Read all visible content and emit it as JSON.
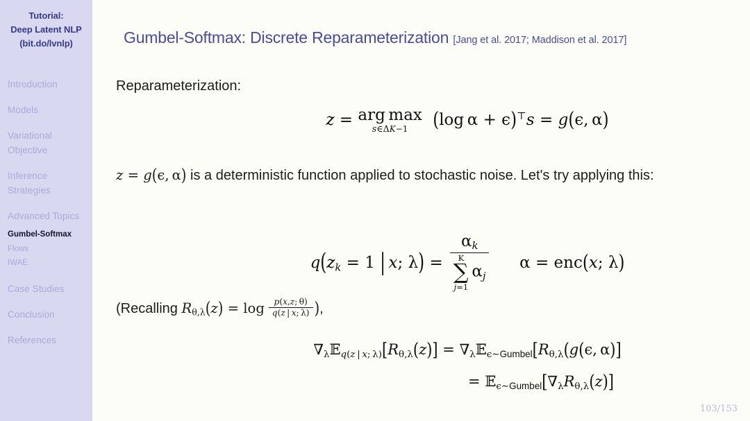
{
  "sidebar": {
    "title_lines": [
      "Tutorial:",
      "Deep Latent NLP",
      "(bit.do/lvnlp)"
    ],
    "items": [
      {
        "label": "Introduction",
        "active": false,
        "level": "section"
      },
      {
        "label": "Models",
        "active": false,
        "level": "section"
      },
      {
        "label": "Variational",
        "active": false,
        "level": "section"
      },
      {
        "label": "Objective",
        "active": false,
        "level": "section-cont"
      },
      {
        "label": "Inference",
        "active": false,
        "level": "section"
      },
      {
        "label": "Strategies",
        "active": false,
        "level": "section-cont"
      },
      {
        "label": "Advanced Topics",
        "active": false,
        "level": "section"
      },
      {
        "label": "Gumbel-Softmax",
        "active": true,
        "level": "subsection"
      },
      {
        "label": "Flows",
        "active": false,
        "level": "subsection"
      },
      {
        "label": "IWAE",
        "active": false,
        "level": "subsection"
      },
      {
        "label": "Case Studies",
        "active": false,
        "level": "section"
      },
      {
        "label": "Conclusion",
        "active": false,
        "level": "section"
      },
      {
        "label": "References",
        "active": false,
        "level": "section"
      }
    ]
  },
  "header": {
    "title": "Gumbel-Softmax: Discrete Reparameterization",
    "citation": "[Jang et al. 2017; Maddison et al. 2017]"
  },
  "content": {
    "intro_label": "Reparameterization:",
    "eq_argmax_plain": "z = argmax_{s in Delta^{K-1}} (log alpha + epsilon)^T s = g(epsilon, alpha)",
    "det_line_prefix": "z = g(ϵ, α)",
    "det_line_text": " is a deterministic function applied to stochastic noise. Let's try applying this:",
    "eq_q_plain": "q(z_k = 1 | x; lambda) = alpha_k / sum_{j=1}^{K} alpha_j     alpha = enc(x; lambda)",
    "recall_prefix": "(Recalling ",
    "recall_eq_plain": "R_{theta,lambda}(z) = log p(x,z;theta)/q(z|x;lambda)",
    "recall_suffix": "),",
    "eq_grad1_plain": "grad_lambda E_{q(z|x;lambda)}[R_{theta,lambda}(z)] = grad_lambda E_{epsilon~Gumbel}[R_{theta,lambda}(g(epsilon, alpha)]",
    "eq_grad2_plain": "= E_{epsilon~Gumbel}[grad_lambda R_{theta,lambda}(z)]",
    "gumbel_label": "Gumbel",
    "enc_label": "enc"
  },
  "footer": {
    "page": "103/153"
  },
  "colors": {
    "sidebar_bg": "#d8d8f0",
    "sidebar_title": "#3a3a8c",
    "sidebar_inactive": "#aaaad8",
    "sidebar_active": "#14142a",
    "title": "#4a4a9e",
    "body": "#1b1b1b",
    "page_num": "#b9b9d8",
    "main_bg": "#fdfdf8"
  }
}
